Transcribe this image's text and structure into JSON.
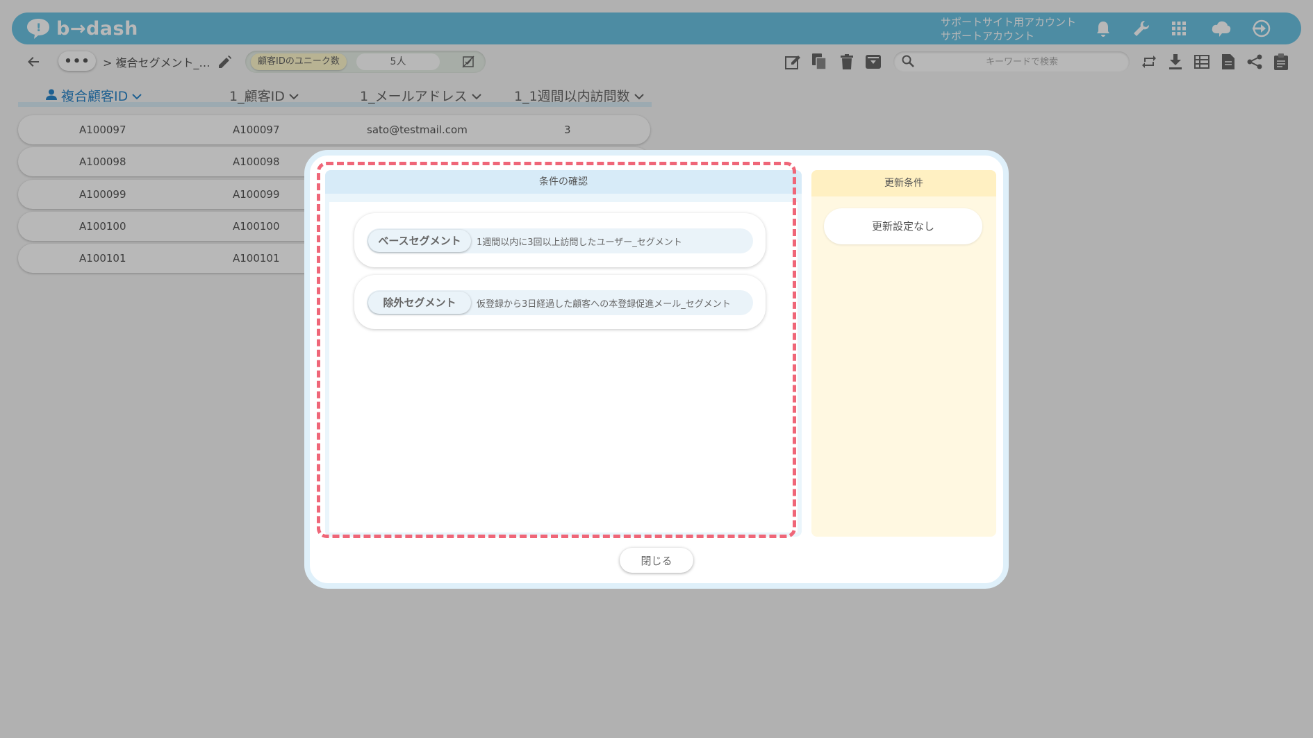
{
  "header": {
    "logo_text": "b→dash",
    "account_line1": "サポートサイト用アカウント",
    "account_line2": "サポートアカウント",
    "icons": [
      "bell-icon",
      "wrench-icon",
      "grid-icon",
      "cloud-chat-icon",
      "logout-icon"
    ],
    "color": "#6bc2e2"
  },
  "toolbar": {
    "more_label": "•••",
    "breadcrumb": "> 複合セグメント_…",
    "unique_label": "顧客IDのユニーク数",
    "unique_count": "5人",
    "search_placeholder": "キーワードで検索",
    "icons": [
      "edit-icon",
      "copy-icon",
      "trash-icon",
      "archive-icon",
      "refresh-icon",
      "download-icon",
      "table-icon",
      "document-icon",
      "share-icon",
      "clipboard-icon"
    ]
  },
  "table": {
    "headers": [
      "複合顧客ID",
      "1_顧客ID",
      "1_メールアドレス",
      "1_1週間以内訪問数"
    ],
    "rows": [
      [
        "A100097",
        "A100097",
        "sato@testmail.com",
        "3"
      ],
      [
        "A100098",
        "A100098",
        "",
        ""
      ],
      [
        "A100099",
        "A100099",
        "",
        ""
      ],
      [
        "A100100",
        "A100100",
        "",
        ""
      ],
      [
        "A100101",
        "A100101",
        "",
        ""
      ]
    ]
  },
  "modal": {
    "left_title": "条件の確認",
    "right_title": "更新条件",
    "segments": [
      {
        "tag": "ベースセグメント",
        "name": "1週間以内に3回以上訪問したユーザー_セグメント"
      },
      {
        "tag": "除外セグメント",
        "name": "仮登録から3日経過した顧客への本登録促進メール_セグメント"
      }
    ],
    "update_setting": "更新設定なし",
    "close_label": "閉じる",
    "highlight_color": "#ef6678"
  }
}
